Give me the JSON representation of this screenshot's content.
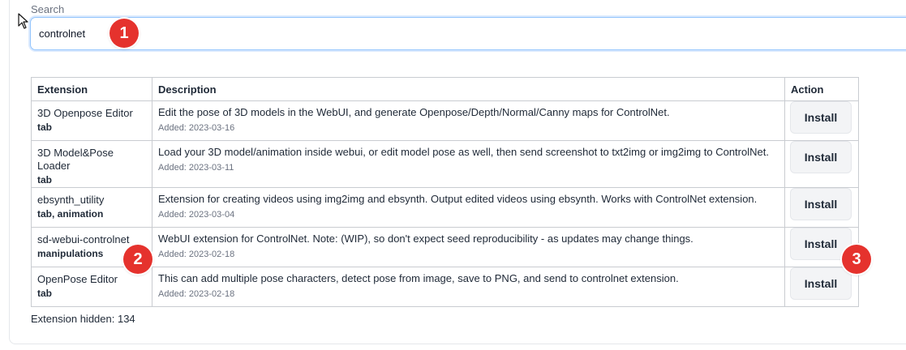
{
  "search": {
    "label": "Search",
    "value": "controlnet"
  },
  "table": {
    "headers": [
      "Extension",
      "Description",
      "Action"
    ],
    "rows": [
      {
        "name": "3D Openpose Editor",
        "tags": "tab",
        "description": "Edit the pose of 3D models in the WebUI, and generate Openpose/Depth/Normal/Canny maps for ControlNet.",
        "added": "Added: 2023-03-16",
        "action": "Install"
      },
      {
        "name": "3D Model&Pose Loader",
        "tags": "tab",
        "description": "Load your 3D model/animation inside webui, or edit model pose as well, then send screenshot to txt2img or img2img to ControlNet.",
        "added": "Added: 2023-03-11",
        "action": "Install"
      },
      {
        "name": "ebsynth_utility",
        "tags": "tab, animation",
        "description": "Extension for creating videos using img2img and ebsynth. Output edited videos using ebsynth. Works with ControlNet extension.",
        "added": "Added: 2023-03-04",
        "action": "Install"
      },
      {
        "name": "sd-webui-controlnet",
        "tags": "manipulations",
        "description": "WebUI extension for ControlNet. Note: (WIP), so don't expect seed reproducibility - as updates may change things.",
        "added": "Added: 2023-02-18",
        "action": "Install"
      },
      {
        "name": "OpenPose Editor",
        "tags": "tab",
        "description": "This can add multiple pose characters, detect pose from image, save to PNG, and send to controlnet extension.",
        "added": "Added: 2023-02-18",
        "action": "Install"
      }
    ]
  },
  "footer": {
    "hidden_text": "Extension hidden: 134"
  },
  "annotations": {
    "badge_1": "1",
    "badge_2": "2",
    "badge_3": "3",
    "color": "#e5322d"
  }
}
